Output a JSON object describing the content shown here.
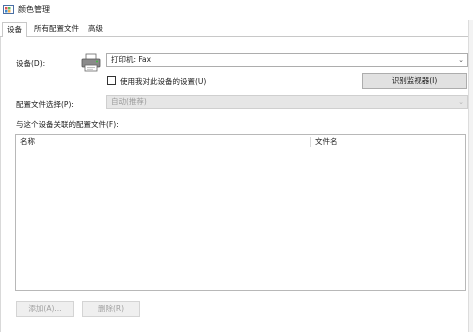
{
  "window": {
    "title": "颜色管理"
  },
  "tabs": [
    {
      "label": "设备",
      "active": true
    },
    {
      "label": "所有配置文件",
      "active": false
    },
    {
      "label": "高级",
      "active": false
    }
  ],
  "device": {
    "label": "设备(D):",
    "selected": "打印机: Fax",
    "use_settings_label": "使用我对此设备的设置(U)",
    "use_settings_checked": false,
    "identify_button": "识别监视器(I)"
  },
  "profile_selection": {
    "label": "配置文件选择(P):",
    "selected": "自动(推荐)"
  },
  "associated_profiles": {
    "label": "与这个设备关联的配置文件(F):",
    "columns": [
      "名称",
      "文件名"
    ],
    "rows": []
  },
  "buttons": {
    "add": "添加(A)...",
    "remove": "删除(R)"
  },
  "icons": {
    "app": "color-management-icon",
    "device": "printer-icon",
    "dropdown": "chevron-down-icon"
  }
}
